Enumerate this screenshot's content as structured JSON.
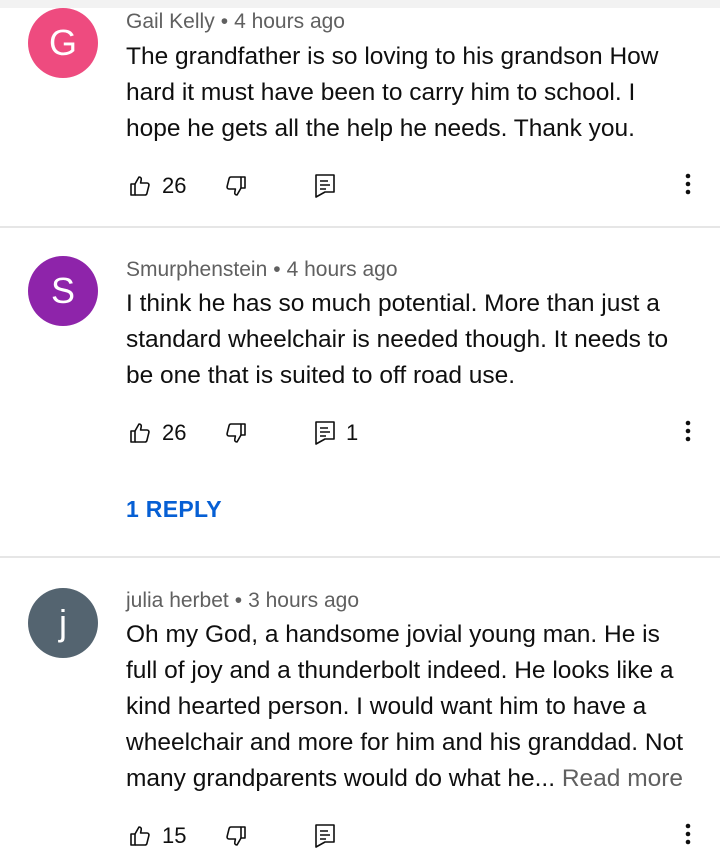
{
  "colors": {
    "accent_link": "#065fd4",
    "meta_gray": "#606060"
  },
  "comments": [
    {
      "author": "Gail Kelly",
      "separator": "•",
      "time": "4 hours ago",
      "avatar_letter": "G",
      "avatar_color": "#ee4b7f",
      "text": "The grandfather is so loving to his grandson  How hard it must have been to carry him to school. I hope he gets all the help he needs. Thank you.",
      "likes": "26",
      "replies_count": "",
      "icons": {
        "like": "thumbs-up-icon",
        "dislike": "thumbs-down-icon",
        "reply": "comment-icon",
        "more": "more-vertical-icon"
      }
    },
    {
      "author": "Smurphenstein",
      "separator": "•",
      "time": "4 hours ago",
      "avatar_letter": "S",
      "avatar_color": "#8e24aa",
      "text": "I think he has so much potential. More than just a standard wheelchair is needed though. It needs to be one that is suited to off road use.",
      "likes": "26",
      "replies_count": "1",
      "reply_link": "1 REPLY",
      "icons": {
        "like": "thumbs-up-icon",
        "dislike": "thumbs-down-icon",
        "reply": "comment-icon",
        "more": "more-vertical-icon"
      }
    },
    {
      "author": "julia herbet",
      "separator": "•",
      "time": "3 hours ago",
      "avatar_letter": "j",
      "avatar_color": "#546470",
      "text": "Oh my God, a handsome jovial young man. He is full of joy and a thunderbolt indeed. He looks like a kind hearted person. I would want him to have a wheelchair and more for him and his granddad. Not many grandparents would do what he...",
      "read_more": "Read more",
      "likes": "15",
      "replies_count": "",
      "icons": {
        "like": "thumbs-up-icon",
        "dislike": "thumbs-down-icon",
        "reply": "comment-icon",
        "more": "more-vertical-icon"
      }
    }
  ]
}
